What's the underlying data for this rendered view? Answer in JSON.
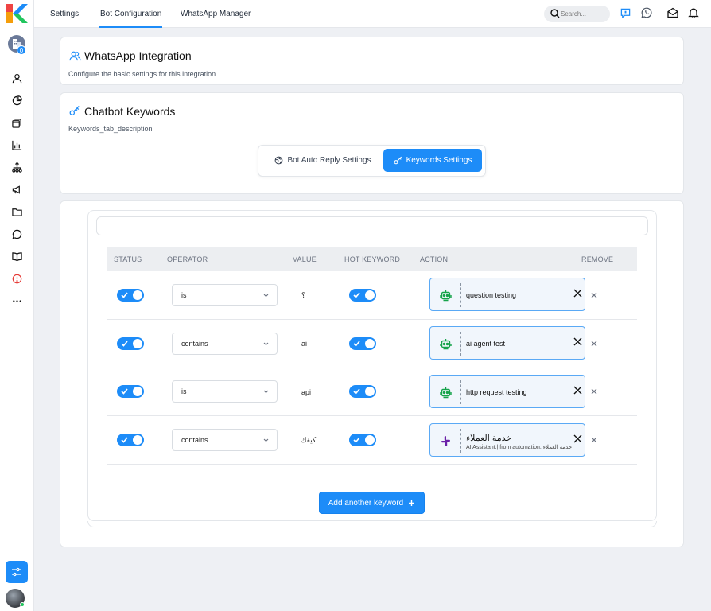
{
  "colors": {
    "accent": "#1d8cf8",
    "background": "#eef0f4"
  },
  "topbar": {
    "tabs": [
      {
        "label": "Settings"
      },
      {
        "label": "Bot Configuration",
        "active": true
      },
      {
        "label": "WhatsApp Manager"
      }
    ],
    "search_placeholder": "Search..."
  },
  "sidebar": {
    "org_badge": "0",
    "icons": [
      "user-icon",
      "pie-chart-icon",
      "layers-icon",
      "bar-chart-icon",
      "hierarchy-icon",
      "megaphone-icon",
      "folder-icon",
      "chat-icon",
      "book-icon",
      "alert-icon",
      "more-icon"
    ]
  },
  "integration": {
    "title": "WhatsApp Integration",
    "description": "Configure the basic settings for this integration"
  },
  "keywords_card": {
    "title": "Chatbot Keywords",
    "description": "Keywords_tab_description",
    "tabs": {
      "bot_auto_reply": "Bot Auto Reply Settings",
      "keywords": "Keywords Settings"
    }
  },
  "table": {
    "headers": {
      "status": "STATUS",
      "operator": "OPERATOR",
      "value": "VALUE",
      "hot_keyword": "HOT KEYWORD",
      "action": "ACTION",
      "remove": "REMOVE"
    },
    "rows": [
      {
        "status": true,
        "operator": "is",
        "value": "؟",
        "hot_keyword": true,
        "action_icon": "bot-icon",
        "action": "question testing"
      },
      {
        "status": true,
        "operator": "contains",
        "value": "ai",
        "hot_keyword": true,
        "action_icon": "bot-icon",
        "action": "ai agent test"
      },
      {
        "status": true,
        "operator": "is",
        "value": "api",
        "hot_keyword": true,
        "action_icon": "bot-icon",
        "action": "http request testing"
      },
      {
        "status": true,
        "operator": "contains",
        "value": "كيفك",
        "hot_keyword": true,
        "action_icon": "slack-icon",
        "action": "خدمة العملاء",
        "action_sub": "AI Assistant:| from automation: خدمة العملاء"
      }
    ]
  },
  "add_button": "Add another keyword"
}
